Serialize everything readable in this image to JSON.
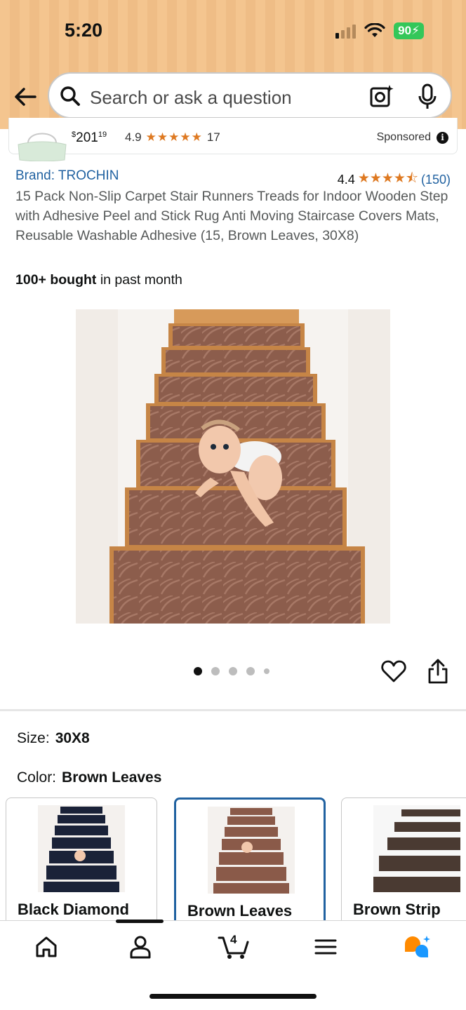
{
  "status_bar": {
    "time": "5:20",
    "battery": "90"
  },
  "search": {
    "placeholder": "Search or ask a question"
  },
  "sponsored": {
    "price_currency": "$",
    "price_whole": "201",
    "price_fraction": "19",
    "rating": "4.9",
    "stars": "★★★★★",
    "review_count": "17",
    "label": "Sponsored"
  },
  "product": {
    "brand": "Brand: TROCHIN",
    "rating": "4.4",
    "stars": "★★★★⯪",
    "review_count": "(150)",
    "title": "15 Pack Non-Slip Carpet Stair Runners Treads for Indoor Wooden Step with Adhesive Peel and Stick Rug Anti Moving Staircase Covers Mats, Reusable Washable Adhesive (15, Brown Leaves, 30X8)",
    "bought_bold": "100+ bought",
    "bought_rest": " in past month"
  },
  "gallery": {
    "image_count": 5,
    "active_index": 0
  },
  "options": {
    "size_label": "Size:",
    "size_value": "30X8",
    "color_label": "Color:",
    "color_value": "Brown Leaves",
    "swatches": [
      {
        "label": "Black Diamond",
        "color": "#1a2238"
      },
      {
        "label": "Brown Leaves",
        "color": "#8a5a49",
        "selected": true
      },
      {
        "label": "Brown Strip",
        "color": "#4a3a32"
      }
    ]
  },
  "bottom_nav": {
    "cart_count": "4"
  },
  "colors": {
    "accent_link": "#2162a1",
    "star": "#de7921",
    "header_bg": "#f4c58f"
  }
}
